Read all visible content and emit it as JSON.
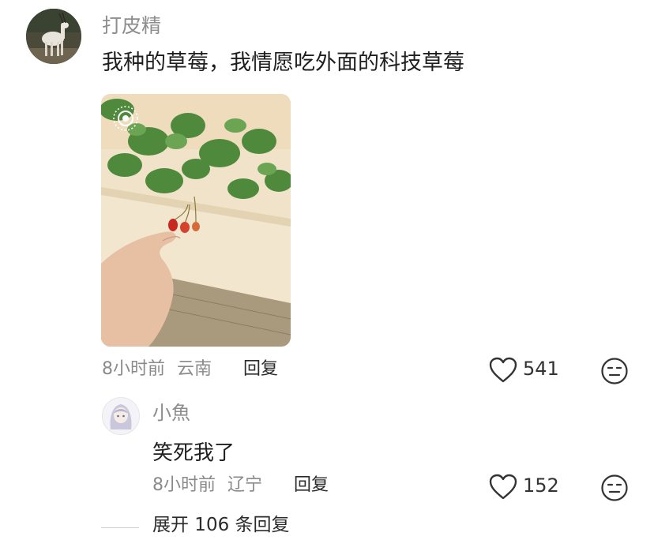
{
  "comment": {
    "username": "打皮精",
    "text": "我种的草莓，我情愿吃外面的科技草莓",
    "time": "8小时前",
    "location": "云南",
    "reply_label": "回复",
    "likes": "541",
    "icons": {
      "like": "heart-outline-icon",
      "emoji": "meh-face-icon",
      "live": "live-photo-icon"
    }
  },
  "reply": {
    "username": "小魚",
    "text": "笑死我了",
    "time": "8小时前",
    "location": "辽宁",
    "reply_label": "回复",
    "likes": "152"
  },
  "expand": {
    "label": "展开 106 条回复"
  },
  "colors": {
    "muted": "#8d8d8d",
    "text": "#1e1e1e",
    "icon": "#333333"
  }
}
